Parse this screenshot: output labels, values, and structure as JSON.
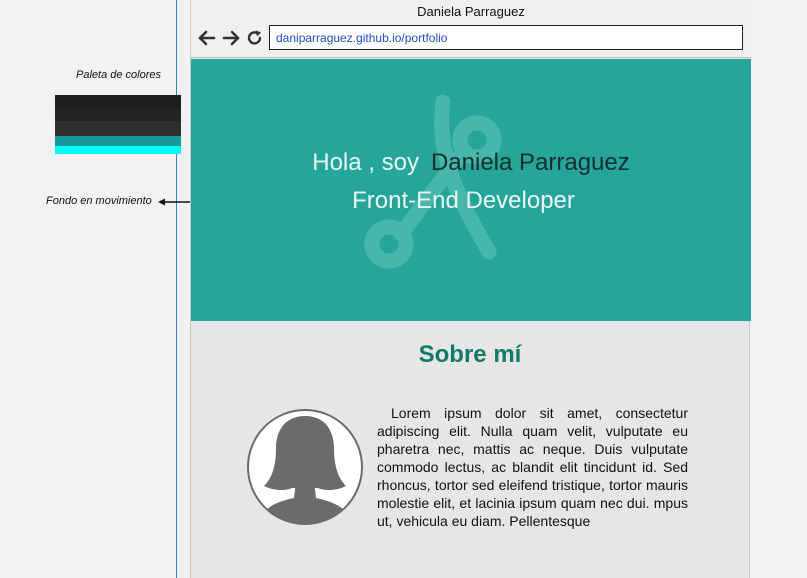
{
  "annotations": {
    "palette_label": "Paleta de colores",
    "palette_colors": [
      "#1e1e1e",
      "#242424",
      "#2f2f2f",
      "#16999b",
      "#00ffff"
    ],
    "background_label": "Fondo en movimiento"
  },
  "browser": {
    "title": "Daniela Parraguez",
    "url": "daniparraguez.github.io/portfolio",
    "nav_icons": [
      "back-arrow-icon",
      "forward-arrow-icon",
      "reload-icon"
    ]
  },
  "hero": {
    "greeting": "Hola , soy",
    "name": "Daniela Parraguez",
    "role": "Front-End Developer",
    "background_color": "#26a69a",
    "logo_icon": "branch-logo-icon"
  },
  "about": {
    "title": "Sobre mí",
    "avatar_icon": "female-avatar-icon",
    "text": "Lorem ipsum dolor sit amet, consectetur adipiscing elit. Nulla quam velit, vulputate eu pharetra nec, mattis ac neque. Duis vulputate commodo lectus, ac blandit elit tincidunt id. Sed rhoncus, tortor sed eleifend tristique, tortor mauris molestie elit, et lacinia ipsum quam nec dui. mpus ut, vehicula eu diam. Pellentesque"
  }
}
